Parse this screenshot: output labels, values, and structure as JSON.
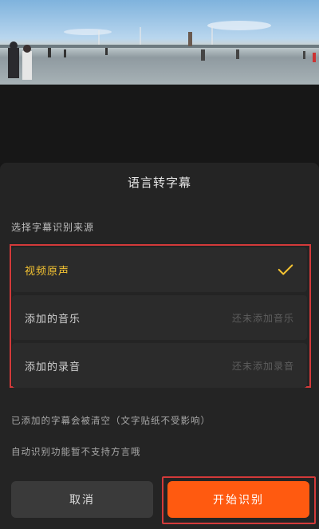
{
  "video_preview": {
    "description_icon": "video-frame"
  },
  "sheet": {
    "title": "语言转字幕",
    "section_label": "选择字幕识别来源",
    "options": [
      {
        "label": "视频原声",
        "hint": "",
        "selected": true
      },
      {
        "label": "添加的音乐",
        "hint": "还未添加音乐",
        "selected": false
      },
      {
        "label": "添加的录音",
        "hint": "还未添加录音",
        "selected": false
      }
    ],
    "notes": [
      "已添加的字幕会被清空（文字贴纸不受影响）",
      "自动识别功能暂不支持方言哦"
    ],
    "buttons": {
      "cancel": "取消",
      "start": "开始识别"
    }
  },
  "colors": {
    "accent": "#ff5a10",
    "selected_text": "#f3c232",
    "highlight_outline": "#d33a3a"
  }
}
